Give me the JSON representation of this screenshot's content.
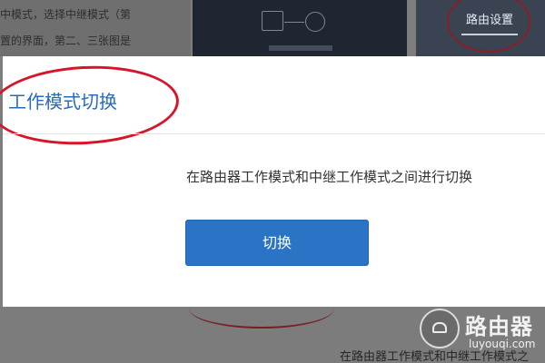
{
  "background": {
    "article_lines": [
      "中模式，选择中继模式（第",
      "置的界面，第二、三张图是"
    ],
    "routing_tab_label": "路由设置",
    "bottom_text": "在路由器工作模式和中继工作模式之"
  },
  "dialog": {
    "title": "工作模式切换",
    "description": "在路由器工作模式和中继工作模式之间进行切换",
    "switch_button_label": "切换"
  },
  "watermark": {
    "brand": "路由器",
    "domain": "luyouqi.com"
  },
  "colors": {
    "title_blue": "#2a6bb8",
    "button_blue": "#2a73c5",
    "annotation_red": "#d6152b",
    "overlay_gray": "#7d7d7d"
  }
}
